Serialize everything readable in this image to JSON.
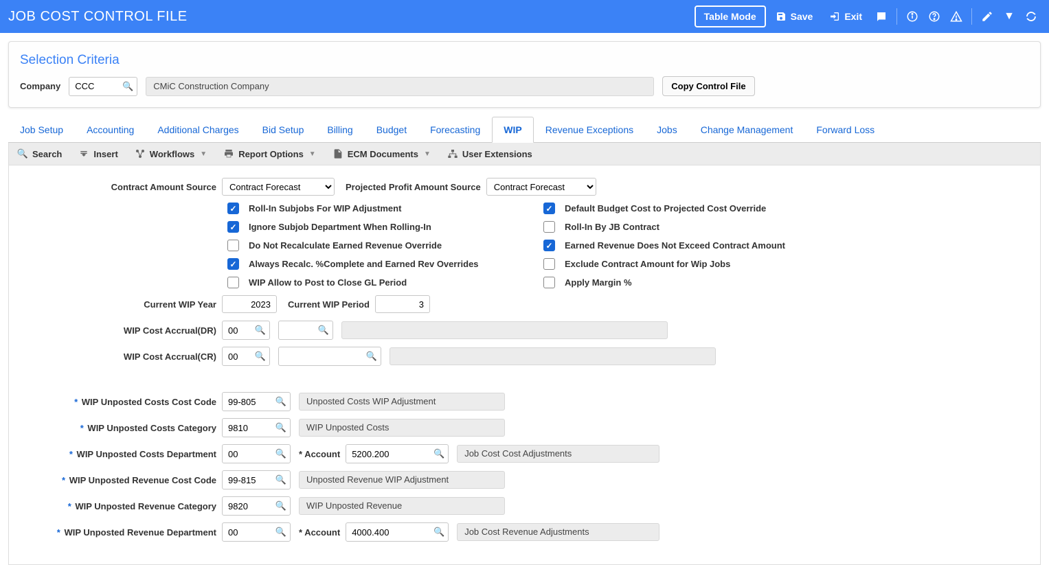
{
  "header": {
    "title": "JOB COST CONTROL FILE",
    "table_mode": "Table Mode",
    "save": "Save",
    "exit": "Exit"
  },
  "selection": {
    "title": "Selection Criteria",
    "company_label": "Company",
    "company_value": "CCC",
    "company_desc": "CMiC Construction Company",
    "copy_btn": "Copy Control File"
  },
  "tabs": [
    "Job Setup",
    "Accounting",
    "Additional Charges",
    "Bid Setup",
    "Billing",
    "Budget",
    "Forecasting",
    "WIP",
    "Revenue Exceptions",
    "Jobs",
    "Change Management",
    "Forward Loss"
  ],
  "active_tab_index": 7,
  "tools": {
    "search": "Search",
    "insert": "Insert",
    "workflows": "Workflows",
    "report": "Report Options",
    "ecm": "ECM Documents",
    "user_ext": "User Extensions"
  },
  "form": {
    "cas_label": "Contract Amount Source",
    "cas_value": "Contract Forecast",
    "ppas_label": "Projected Profit Amount Source",
    "ppas_value": "Contract Forecast",
    "checks_left": [
      {
        "label": "Roll-In Subjobs For WIP Adjustment",
        "checked": true
      },
      {
        "label": "Ignore Subjob Department When Rolling-In",
        "checked": true
      },
      {
        "label": "Do Not Recalculate Earned Revenue Override",
        "checked": false
      },
      {
        "label": "Always Recalc. %Complete and Earned Rev Overrides",
        "checked": true
      },
      {
        "label": "WIP Allow to Post to Close GL Period",
        "checked": false
      }
    ],
    "checks_right": [
      {
        "label": "Default Budget Cost to Projected Cost Override",
        "checked": true
      },
      {
        "label": "Roll-In By JB Contract",
        "checked": false
      },
      {
        "label": "Earned Revenue Does Not Exceed Contract Amount",
        "checked": true
      },
      {
        "label": "Exclude Contract Amount for Wip Jobs",
        "checked": false
      },
      {
        "label": "Apply Margin %",
        "checked": false
      }
    ],
    "cur_year_label": "Current WIP Year",
    "cur_year": "2023",
    "cur_period_label": "Current WIP Period",
    "cur_period": "3",
    "accrual_dr_label": "WIP Cost Accrual(DR)",
    "accrual_dr": "00",
    "accrual_cr_label": "WIP Cost Accrual(CR)",
    "accrual_cr": "00",
    "rows": [
      {
        "label": "WIP Unposted Costs Cost Code",
        "v": "99-805",
        "desc": "Unposted Costs WIP Adjustment"
      },
      {
        "label": "WIP Unposted Costs Category",
        "v": "9810",
        "desc": "WIP Unposted Costs"
      },
      {
        "label": "WIP Unposted Costs Department",
        "v": "00",
        "acct_label": "Account",
        "acct": "5200.200",
        "acct_desc": "Job Cost Cost Adjustments"
      },
      {
        "label": "WIP Unposted Revenue Cost Code",
        "v": "99-815",
        "desc": "Unposted Revenue WIP Adjustment"
      },
      {
        "label": "WIP Unposted Revenue Category",
        "v": "9820",
        "desc": "WIP Unposted Revenue"
      },
      {
        "label": "WIP Unposted Revenue Department",
        "v": "00",
        "acct_label": "Account",
        "acct": "4000.400",
        "acct_desc": "Job Cost Revenue Adjustments"
      }
    ]
  }
}
